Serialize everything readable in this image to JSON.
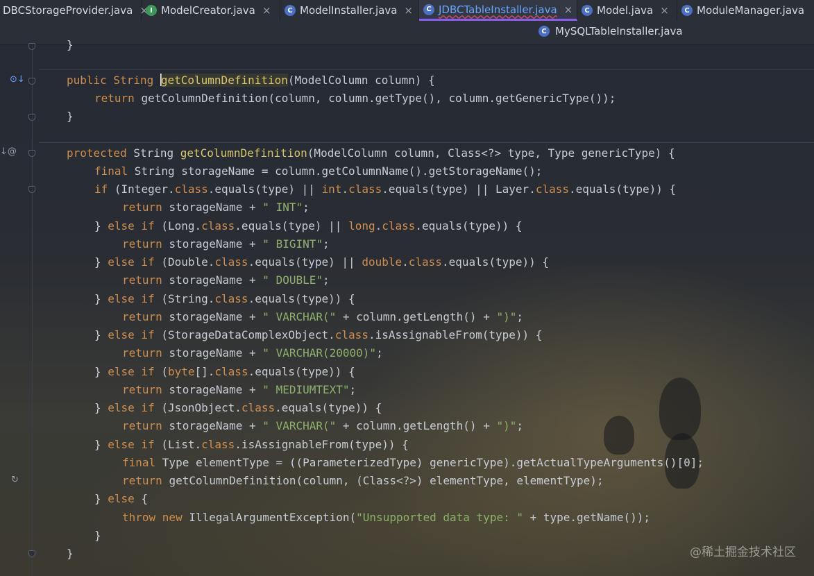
{
  "tabs": [
    {
      "label": "JDBCStorageProvider.java",
      "icon": "class-icon",
      "shown": "DBCStorageProvider.java"
    },
    {
      "label": "ModelCreator.java",
      "icon": "interface-icon"
    },
    {
      "label": "ModelInstaller.java",
      "icon": "class-icon"
    },
    {
      "label": "JDBCTableInstaller.java",
      "icon": "class-icon",
      "active": true
    },
    {
      "label": "Model.java",
      "icon": "class-icon"
    },
    {
      "label": "ModuleManager.java",
      "icon": "class-icon"
    }
  ],
  "tab_row2": {
    "label": "MySQLTableInstaller.java",
    "icon": "class-icon"
  },
  "close_glyph": "×",
  "icon_letters": {
    "class": "C",
    "interface": "I"
  },
  "code": {
    "l0": "}",
    "m1_a": "public String ",
    "m1_fn": "getColumnDefinition",
    "m1_b": "(ModelColumn column) {",
    "m1_ret_kw": "return ",
    "m1_ret": "getColumnDefinition(column, column.getType(), column.getGenericType());",
    "close1": "}",
    "m2_kw": "protected ",
    "m2_a": "String ",
    "m2_fn": "getColumnDefinition",
    "m2_b": "(ModelColumn column, Class<?> type, Type genericType) {",
    "l_final_kw": "final ",
    "l_final": "String storageName = column.getColumnName().getStorageName();",
    "if1_kw": "if ",
    "if1_a": "(Integer.",
    "if1_cls": "class",
    "if1_b": ".equals(type) || ",
    "if1_int": "int",
    "if1_c": ".",
    "if1_cls2": "class",
    "if1_d": ".equals(type) || Layer.",
    "if1_cls3": "class",
    "if1_e": ".equals(type)) {",
    "r_kw": "return ",
    "r_sn": "storageName + ",
    "s_int": "\" INT\"",
    "elif_close": "} ",
    "elif_kw": "else if ",
    "if2_a": "(Long.",
    "if2_b": ".equals(type) || ",
    "if2_long": "long",
    "if2_c": ".equals(type)) {",
    "s_bigint": "\" BIGINT\"",
    "if3_a": "(Double.",
    "if3_b": ".equals(type) || ",
    "if3_double": "double",
    "if3_c": ".equals(type)) {",
    "s_double": "\" DOUBLE\"",
    "if4_a": "(String.",
    "if4_b": ".equals(type)) {",
    "s_varchar": "\" VARCHAR(\"",
    "r_len": " + column.getLength() + ",
    "s_paren": "\")\"",
    "if5_a": "(StorageDataComplexObject.",
    "if5_b": ".isAssignableFrom(type)) {",
    "s_varchar2": "\" VARCHAR(20000)\"",
    "if6_a": "(",
    "if6_byte": "byte",
    "if6_b": "[].",
    "if6_c": ".equals(type)) {",
    "s_medium": "\" MEDIUMTEXT\"",
    "if7_a": "(JsonObject.",
    "if7_b": ".equals(type)) {",
    "if8_a": "(List.",
    "if8_b": ".isAssignableFrom(type)) {",
    "fin2_kw": "final ",
    "fin2": "Type elementType = ((ParameterizedType) genericType).getActualTypeArguments()[0];",
    "ret2": "getColumnDefinition(column, (Class<?>) elementType, elementType);",
    "else_kw": "else ",
    "brace": "{",
    "throw_kw": "throw ",
    "new_kw": "new ",
    "throw_a": "IllegalArgumentException(",
    "s_unsup": "\"Unsupported data type: \"",
    "throw_b": " + type.getName());",
    "semi": ";",
    "cls": "class"
  },
  "watermark": "@稀土掘金技术社区"
}
